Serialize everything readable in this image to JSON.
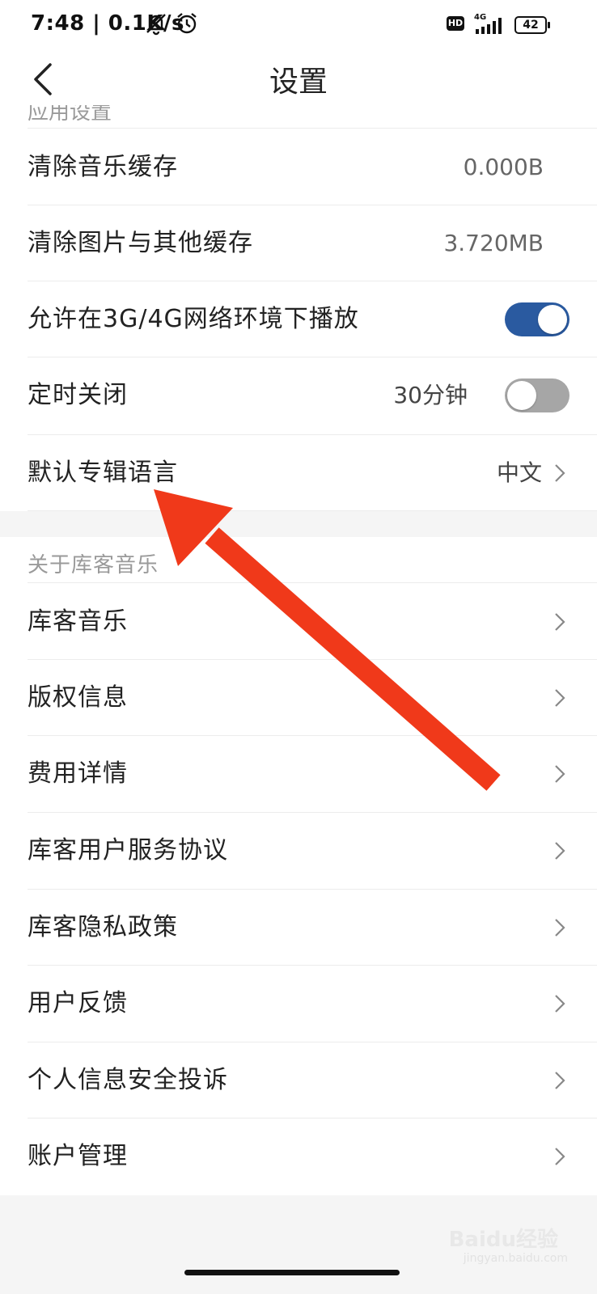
{
  "status_bar": {
    "time": "7:48",
    "speed": "0.1K/s",
    "network": "4G",
    "hd": "HD",
    "battery": "42"
  },
  "header": {
    "title": "设置",
    "back_icon": "chevron-left-icon"
  },
  "partial_section_title": "应用设置",
  "app_settings": {
    "clear_music_cache": {
      "label": "清除音乐缓存",
      "value": "0.000B"
    },
    "clear_image_cache": {
      "label": "清除图片与其他缓存",
      "value": "3.720MB"
    },
    "allow_mobile_play": {
      "label": "允许在3G/4G网络环境下播放",
      "on": true
    },
    "timer_off": {
      "label": "定时关闭",
      "value": "30分钟",
      "on": false
    },
    "album_language": {
      "label": "默认专辑语言",
      "value": "中文"
    }
  },
  "about_section": {
    "title": "关于库客音乐",
    "items": [
      {
        "label": "库客音乐"
      },
      {
        "label": "版权信息"
      },
      {
        "label": "费用详情"
      },
      {
        "label": "库客用户服务协议"
      },
      {
        "label": "库客隐私政策"
      },
      {
        "label": "用户反馈"
      },
      {
        "label": "个人信息安全投诉"
      },
      {
        "label": "账户管理"
      }
    ]
  },
  "watermark": {
    "brand": "Baidu经验",
    "url": "jingyan.baidu.com"
  },
  "colors": {
    "toggle_on": "#2a5aa0",
    "toggle_off": "#a6a6a6",
    "arrow": "#f0391a"
  }
}
